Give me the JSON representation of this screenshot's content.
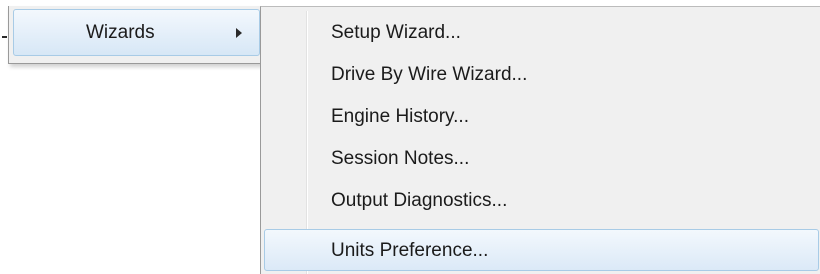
{
  "parent_menu": {
    "highlighted_item": {
      "label": "Wizards"
    }
  },
  "submenu": {
    "items": [
      {
        "label": "Setup Wizard..."
      },
      {
        "label": "Drive By Wire Wizard..."
      },
      {
        "label": "Engine History..."
      },
      {
        "label": "Session Notes..."
      },
      {
        "label": "Output Diagnostics..."
      },
      {
        "label": "Units Preference..."
      }
    ],
    "hovered_label": "Units Preference..."
  },
  "colors": {
    "menu_background": "#f0f0f0",
    "highlight_border": "#a8cbe6",
    "highlight_fill_top": "#f3f8fd",
    "highlight_fill_bottom": "#d7e7f6",
    "text": "#1b1b1b"
  },
  "icons": {
    "submenu_indicator": "chevron-right-icon"
  }
}
